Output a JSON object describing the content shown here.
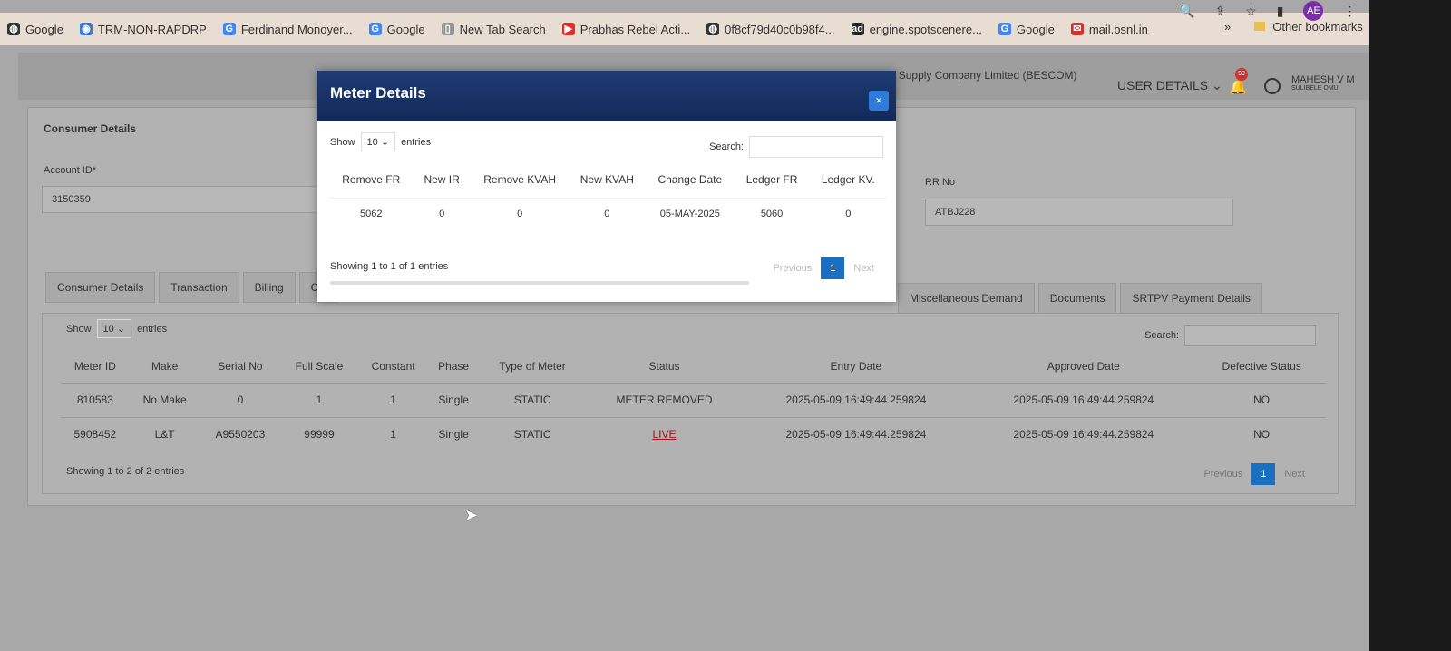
{
  "browser": {
    "bookmarks": [
      {
        "label": "Google",
        "icon": "globe-icon"
      },
      {
        "label": "TRM-NON-RAPDRP",
        "icon": "site-icon"
      },
      {
        "label": "Ferdinand Monoyer...",
        "icon": "google-icon"
      },
      {
        "label": "Google",
        "icon": "google-icon"
      },
      {
        "label": "New Tab Search",
        "icon": "page-icon"
      },
      {
        "label": "Prabhas Rebel Acti...",
        "icon": "youtube-icon"
      },
      {
        "label": "0f8cf79d40c0b98f4...",
        "icon": "globe-icon"
      },
      {
        "label": "engine.spotscenere...",
        "icon": "ad-icon"
      },
      {
        "label": "Google",
        "icon": "google-icon"
      },
      {
        "label": "mail.bsnl.in",
        "icon": "mail-icon"
      }
    ],
    "overflow": "»",
    "other_bookmarks": "Other bookmarks",
    "profile": "AE"
  },
  "header": {
    "company": "Bangalore Electricity Supply Company Limited (BESCOM)",
    "user_details": "USER DETAILS",
    "notif_count": "99",
    "user_name": "MAHESH V M",
    "user_role": "SULIBELE OMU"
  },
  "consumer": {
    "title": "Consumer Details",
    "account_label": "Account ID*",
    "account_value": "3150359",
    "rr_label": "RR No",
    "rr_value": "ATBJ228"
  },
  "tabs": [
    "Consumer Details",
    "Transaction",
    "Billing",
    "Old"
  ],
  "tabs_right": [
    "Miscellaneous Demand",
    "Documents",
    "SRTPV Payment Details"
  ],
  "meters": {
    "show": "Show",
    "entries_value": "10",
    "entries": "entries",
    "search": "Search:",
    "columns": [
      "Meter ID",
      "Make",
      "Serial No",
      "Full Scale",
      "Constant",
      "Phase",
      "Type of Meter",
      "Status",
      "Entry Date",
      "Approved Date",
      "Defective Status"
    ],
    "rows": [
      [
        "810583",
        "No Make",
        "0",
        "1",
        "1",
        "Single",
        "STATIC",
        "METER REMOVED",
        "2025-05-09 16:49:44.259824",
        "2025-05-09 16:49:44.259824",
        "NO"
      ],
      [
        "5908452",
        "L&T",
        "A9550203",
        "99999",
        "1",
        "Single",
        "STATIC",
        "LIVE",
        "2025-05-09 16:49:44.259824",
        "2025-05-09 16:49:44.259824",
        "NO"
      ]
    ],
    "info": "Showing 1 to 2 of 2 entries",
    "previous": "Previous",
    "page": "1",
    "next": "Next"
  },
  "modal": {
    "title": "Meter Details",
    "close": "×",
    "show": "Show",
    "entries_value": "10",
    "entries": "entries",
    "search": "Search:",
    "columns": [
      "Remove FR",
      "New IR",
      "Remove KVAH",
      "New KVAH",
      "Change Date",
      "Ledger FR",
      "Ledger KV."
    ],
    "rows": [
      [
        "5062",
        "0",
        "0",
        "0",
        "05-MAY-2025",
        "5060",
        "0"
      ]
    ],
    "info": "Showing 1 to 1 of 1 entries",
    "previous": "Previous",
    "page": "1",
    "next": "Next"
  }
}
